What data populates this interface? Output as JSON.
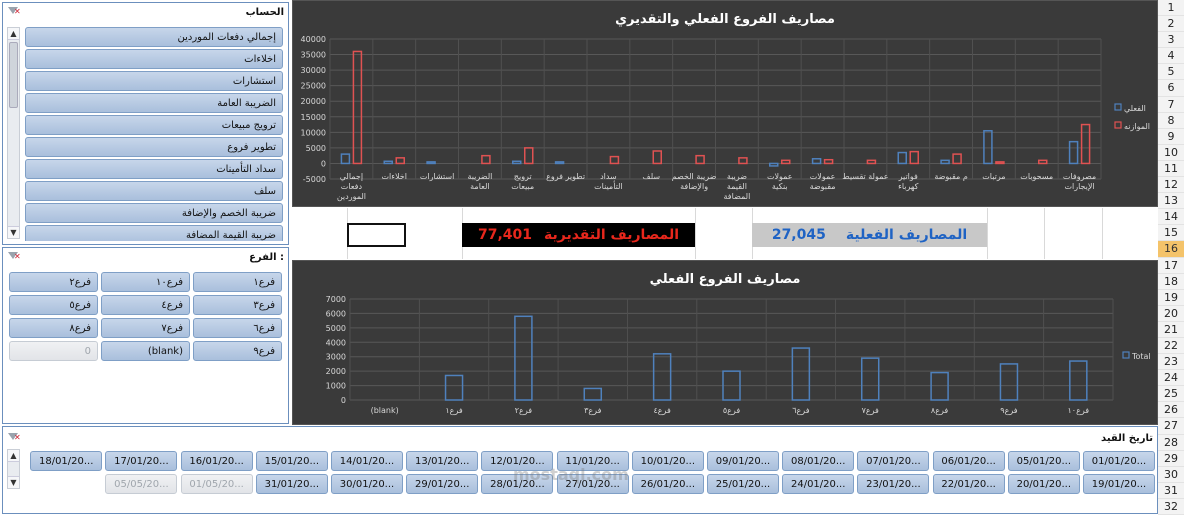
{
  "account_slicer": {
    "title": "الحساب",
    "items": [
      "إجمالي دفعات الموردين",
      "اخلاءات",
      "استشارات",
      "الضريبة العامة",
      "ترويج مبيعات",
      "تطوير فروع",
      "سداد التأمينات",
      "سلف",
      "ضريبة الخصم والإضافة",
      "ضريبة القيمة المضافة"
    ]
  },
  "branch_slicer": {
    "title": "الفرع :",
    "rows": [
      [
        "فرع١",
        "فرع١٠",
        "فرع٢"
      ],
      [
        "فرع٣",
        "فرع٤",
        "فرع٥"
      ],
      [
        "فرع٦",
        "فرع٧",
        "فرع٨"
      ],
      [
        "فرع٩",
        "(blank)",
        "0"
      ]
    ]
  },
  "date_slicer": {
    "title": "تاريخ القيد",
    "row1": [
      "01/01/20...",
      "05/01/20...",
      "06/01/20...",
      "07/01/20...",
      "08/01/20...",
      "09/01/20...",
      "10/01/20...",
      "11/01/20...",
      "12/01/20...",
      "13/01/20...",
      "14/01/20...",
      "15/01/20...",
      "16/01/20...",
      "17/01/20...",
      "18/01/20..."
    ],
    "row2": [
      "19/01/20...",
      "20/01/20...",
      "22/01/20...",
      "23/01/20...",
      "24/01/20...",
      "25/01/20...",
      "26/01/20...",
      "27/01/20...",
      "28/01/20...",
      "29/01/20...",
      "30/01/20...",
      "31/01/20...",
      "01/05/20...",
      "05/05/20..."
    ]
  },
  "kpis": {
    "actual_label": "المصاريف الفعلية",
    "actual_value": "27,045",
    "estimated_label": "المصاريف التقديرية",
    "estimated_value": "77,401"
  },
  "colors": {
    "actual": "#4f81bd",
    "budget": "#e05252",
    "chart_bg": "#3a3a3a",
    "kpi_red": "#e8271c",
    "kpi_blue": "#1f63c4"
  },
  "watermark": {
    "text": "mostaql.com"
  },
  "row_numbers": [
    "1",
    "2",
    "3",
    "4",
    "5",
    "6",
    "7",
    "8",
    "9",
    "10",
    "11",
    "12",
    "13",
    "14",
    "15",
    "16",
    "17",
    "18",
    "19",
    "20",
    "21",
    "22",
    "23",
    "24",
    "25",
    "26",
    "27",
    "28",
    "29",
    "30",
    "31",
    "32"
  ],
  "active_row": "16",
  "chart_data": [
    {
      "type": "bar",
      "title": "مصاريف الفروع الفعلي والتقديري",
      "categories": [
        "إجمالي دفعات الموردين",
        "اخلاءات",
        "استشارات",
        "الضريبة العامة",
        "ترويج مبيعات",
        "تطوير فروع",
        "سداد التأمينات",
        "سلف",
        "ضريبة الخصم والإضافة",
        "ضريبة القيمة المضافة",
        "عمولات بنكية",
        "عمولات مقبوضة",
        "عمولة تقسيط",
        "فواتير كهرباء",
        "م مقبوضة",
        "مرتبات",
        "مسحوبات",
        "مصروفات الإيجارات"
      ],
      "series": [
        {
          "name": "الفعلي",
          "values": [
            3000,
            700,
            500,
            0,
            700,
            500,
            0,
            0,
            0,
            0,
            -800,
            1500,
            0,
            3500,
            1000,
            10500,
            0,
            7000
          ]
        },
        {
          "name": "الموازنه",
          "values": [
            36000,
            1800,
            0,
            2500,
            5000,
            0,
            2200,
            4000,
            2500,
            1800,
            1000,
            1200,
            1000,
            3800,
            3000,
            500,
            1000,
            12500
          ]
        }
      ],
      "yticks": [
        "40000",
        "35000",
        "30000",
        "25000",
        "20000",
        "15000",
        "10000",
        "5000",
        "0",
        "-5000"
      ],
      "ylim": [
        -5000,
        40000
      ],
      "legend": "right"
    },
    {
      "type": "bar",
      "title": "مصاريف الفروع الفعلي",
      "categories": [
        "(blank)",
        "فرع١",
        "فرع٢",
        "فرع٣",
        "فرع٤",
        "فرع٥",
        "فرع٦",
        "فرع٧",
        "فرع٨",
        "فرع٩",
        "فرع١٠"
      ],
      "series": [
        {
          "name": "Total",
          "values": [
            0,
            1700,
            5800,
            800,
            3200,
            2000,
            3600,
            2900,
            1900,
            2500,
            2700
          ]
        }
      ],
      "yticks": [
        "7000",
        "6000",
        "5000",
        "4000",
        "3000",
        "2000",
        "1000",
        "0"
      ],
      "ylim": [
        0,
        7000
      ],
      "legend": "right"
    }
  ]
}
